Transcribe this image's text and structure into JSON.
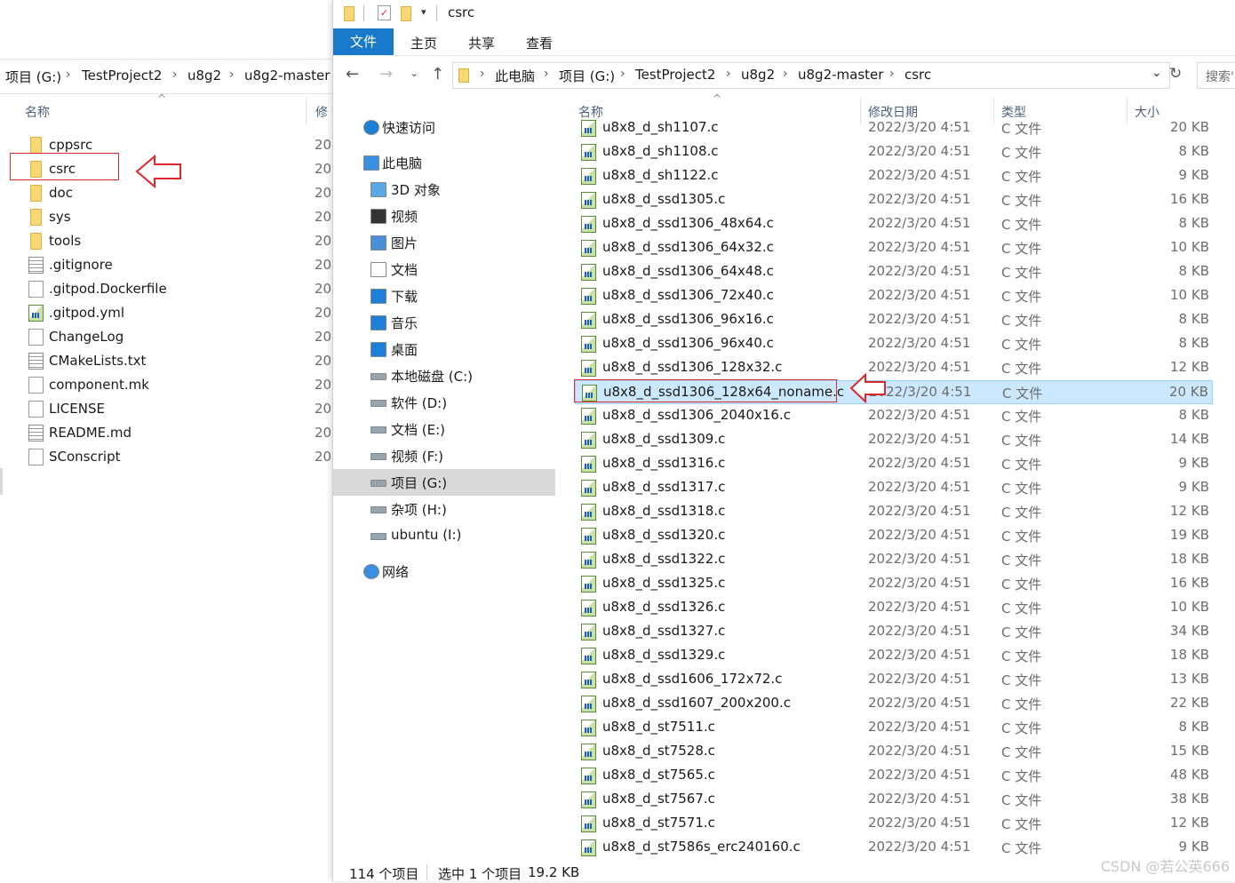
{
  "left_window": {
    "breadcrumb": [
      "项目 (G:)",
      "TestProject2",
      "u8g2",
      "u8g2-master"
    ],
    "col_name": "名称",
    "col_date_partial": "修",
    "items": [
      {
        "name": "cppsrc",
        "type": "folder",
        "date": "20"
      },
      {
        "name": "csrc",
        "type": "folder",
        "date": "20"
      },
      {
        "name": "doc",
        "type": "folder",
        "date": "20"
      },
      {
        "name": "sys",
        "type": "folder",
        "date": "20"
      },
      {
        "name": "tools",
        "type": "folder",
        "date": "20"
      },
      {
        "name": ".gitignore",
        "type": "doc-lined",
        "date": "20"
      },
      {
        "name": ".gitpod.Dockerfile",
        "type": "doc",
        "date": "20"
      },
      {
        "name": ".gitpod.yml",
        "type": "cfile",
        "date": "20"
      },
      {
        "name": "ChangeLog",
        "type": "doc",
        "date": "20"
      },
      {
        "name": "CMakeLists.txt",
        "type": "doc-lined",
        "date": "20"
      },
      {
        "name": "component.mk",
        "type": "doc",
        "date": "20"
      },
      {
        "name": "LICENSE",
        "type": "doc",
        "date": "20"
      },
      {
        "name": "README.md",
        "type": "doc-lined",
        "date": "20"
      },
      {
        "name": "SConscript",
        "type": "doc",
        "date": "20"
      }
    ]
  },
  "right_window": {
    "title": "csrc",
    "ribbon_tabs": {
      "file": "文件",
      "home": "主页",
      "share": "共享",
      "view": "查看"
    },
    "breadcrumb": [
      "此电脑",
      "项目 (G:)",
      "TestProject2",
      "u8g2",
      "u8g2-master",
      "csrc"
    ],
    "search_placeholder": "搜索'",
    "columns": {
      "name": "名称",
      "date": "修改日期",
      "type": "类型",
      "size": "大小"
    },
    "nav": [
      {
        "label": "快速访问",
        "icon": "star-icon",
        "indent": 0
      },
      {
        "label": "此电脑",
        "icon": "computer-icon",
        "indent": 0
      },
      {
        "label": "3D 对象",
        "icon": "cube-icon",
        "indent": 1
      },
      {
        "label": "视频",
        "icon": "film-icon",
        "indent": 1
      },
      {
        "label": "图片",
        "icon": "picture-icon",
        "indent": 1
      },
      {
        "label": "文档",
        "icon": "document-icon",
        "indent": 1
      },
      {
        "label": "下载",
        "icon": "download-icon",
        "indent": 1
      },
      {
        "label": "音乐",
        "icon": "music-icon",
        "indent": 1
      },
      {
        "label": "桌面",
        "icon": "desktop-icon",
        "indent": 1
      },
      {
        "label": "本地磁盘 (C:)",
        "icon": "system-drive-icon",
        "indent": 1
      },
      {
        "label": "软件 (D:)",
        "icon": "drive-icon",
        "indent": 1
      },
      {
        "label": "文档 (E:)",
        "icon": "drive-icon",
        "indent": 1
      },
      {
        "label": "视频 (F:)",
        "icon": "drive-icon",
        "indent": 1
      },
      {
        "label": "项目 (G:)",
        "icon": "drive-icon",
        "indent": 1,
        "selected": true
      },
      {
        "label": "杂项 (H:)",
        "icon": "drive-icon",
        "indent": 1
      },
      {
        "label": "ubuntu (I:)",
        "icon": "drive-icon",
        "indent": 1
      },
      {
        "label": "网络",
        "icon": "network-icon",
        "indent": 0
      }
    ],
    "files": [
      {
        "name": "u8x8_d_sh1107.c",
        "date": "2022/3/20 4:51",
        "type": "C 文件",
        "size": "20 KB"
      },
      {
        "name": "u8x8_d_sh1108.c",
        "date": "2022/3/20 4:51",
        "type": "C 文件",
        "size": "8 KB"
      },
      {
        "name": "u8x8_d_sh1122.c",
        "date": "2022/3/20 4:51",
        "type": "C 文件",
        "size": "9 KB"
      },
      {
        "name": "u8x8_d_ssd1305.c",
        "date": "2022/3/20 4:51",
        "type": "C 文件",
        "size": "16 KB"
      },
      {
        "name": "u8x8_d_ssd1306_48x64.c",
        "date": "2022/3/20 4:51",
        "type": "C 文件",
        "size": "8 KB"
      },
      {
        "name": "u8x8_d_ssd1306_64x32.c",
        "date": "2022/3/20 4:51",
        "type": "C 文件",
        "size": "10 KB"
      },
      {
        "name": "u8x8_d_ssd1306_64x48.c",
        "date": "2022/3/20 4:51",
        "type": "C 文件",
        "size": "8 KB"
      },
      {
        "name": "u8x8_d_ssd1306_72x40.c",
        "date": "2022/3/20 4:51",
        "type": "C 文件",
        "size": "10 KB"
      },
      {
        "name": "u8x8_d_ssd1306_96x16.c",
        "date": "2022/3/20 4:51",
        "type": "C 文件",
        "size": "8 KB"
      },
      {
        "name": "u8x8_d_ssd1306_96x40.c",
        "date": "2022/3/20 4:51",
        "type": "C 文件",
        "size": "8 KB"
      },
      {
        "name": "u8x8_d_ssd1306_128x32.c",
        "date": "2022/3/20 4:51",
        "type": "C 文件",
        "size": "12 KB"
      },
      {
        "name": "u8x8_d_ssd1306_128x64_noname.c",
        "date": "2022/3/20 4:51",
        "type": "C 文件",
        "size": "20 KB",
        "selected": true
      },
      {
        "name": "u8x8_d_ssd1306_2040x16.c",
        "date": "2022/3/20 4:51",
        "type": "C 文件",
        "size": "8 KB"
      },
      {
        "name": "u8x8_d_ssd1309.c",
        "date": "2022/3/20 4:51",
        "type": "C 文件",
        "size": "14 KB"
      },
      {
        "name": "u8x8_d_ssd1316.c",
        "date": "2022/3/20 4:51",
        "type": "C 文件",
        "size": "9 KB"
      },
      {
        "name": "u8x8_d_ssd1317.c",
        "date": "2022/3/20 4:51",
        "type": "C 文件",
        "size": "9 KB"
      },
      {
        "name": "u8x8_d_ssd1318.c",
        "date": "2022/3/20 4:51",
        "type": "C 文件",
        "size": "12 KB"
      },
      {
        "name": "u8x8_d_ssd1320.c",
        "date": "2022/3/20 4:51",
        "type": "C 文件",
        "size": "19 KB"
      },
      {
        "name": "u8x8_d_ssd1322.c",
        "date": "2022/3/20 4:51",
        "type": "C 文件",
        "size": "18 KB"
      },
      {
        "name": "u8x8_d_ssd1325.c",
        "date": "2022/3/20 4:51",
        "type": "C 文件",
        "size": "16 KB"
      },
      {
        "name": "u8x8_d_ssd1326.c",
        "date": "2022/3/20 4:51",
        "type": "C 文件",
        "size": "10 KB"
      },
      {
        "name": "u8x8_d_ssd1327.c",
        "date": "2022/3/20 4:51",
        "type": "C 文件",
        "size": "34 KB"
      },
      {
        "name": "u8x8_d_ssd1329.c",
        "date": "2022/3/20 4:51",
        "type": "C 文件",
        "size": "18 KB"
      },
      {
        "name": "u8x8_d_ssd1606_172x72.c",
        "date": "2022/3/20 4:51",
        "type": "C 文件",
        "size": "13 KB"
      },
      {
        "name": "u8x8_d_ssd1607_200x200.c",
        "date": "2022/3/20 4:51",
        "type": "C 文件",
        "size": "22 KB"
      },
      {
        "name": "u8x8_d_st7511.c",
        "date": "2022/3/20 4:51",
        "type": "C 文件",
        "size": "8 KB"
      },
      {
        "name": "u8x8_d_st7528.c",
        "date": "2022/3/20 4:51",
        "type": "C 文件",
        "size": "15 KB"
      },
      {
        "name": "u8x8_d_st7565.c",
        "date": "2022/3/20 4:51",
        "type": "C 文件",
        "size": "48 KB"
      },
      {
        "name": "u8x8_d_st7567.c",
        "date": "2022/3/20 4:51",
        "type": "C 文件",
        "size": "38 KB"
      },
      {
        "name": "u8x8_d_st7571.c",
        "date": "2022/3/20 4:51",
        "type": "C 文件",
        "size": "12 KB"
      },
      {
        "name": "u8x8_d_st7586s_erc240160.c",
        "date": "2022/3/20 4:51",
        "type": "C 文件",
        "size": "9 KB"
      }
    ],
    "status": {
      "count": "114 个项目",
      "selected": "选中 1 个项目",
      "size": "19.2 KB"
    }
  },
  "watermark": "CSDN @若公英666",
  "colors": {
    "accent": "#1979ca",
    "selection": "#cce8ff",
    "annotation": "#e0262d"
  }
}
